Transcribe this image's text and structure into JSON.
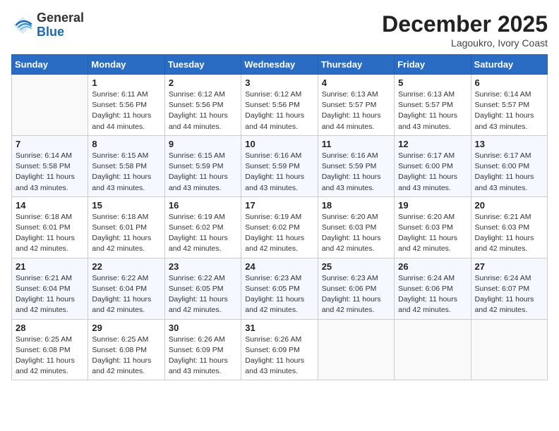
{
  "header": {
    "logo_line1": "General",
    "logo_line2": "Blue",
    "month_title": "December 2025",
    "location": "Lagoukro, Ivory Coast"
  },
  "weekdays": [
    "Sunday",
    "Monday",
    "Tuesday",
    "Wednesday",
    "Thursday",
    "Friday",
    "Saturday"
  ],
  "weeks": [
    [
      {
        "day": "",
        "info": ""
      },
      {
        "day": "1",
        "info": "Sunrise: 6:11 AM\nSunset: 5:56 PM\nDaylight: 11 hours\nand 44 minutes."
      },
      {
        "day": "2",
        "info": "Sunrise: 6:12 AM\nSunset: 5:56 PM\nDaylight: 11 hours\nand 44 minutes."
      },
      {
        "day": "3",
        "info": "Sunrise: 6:12 AM\nSunset: 5:56 PM\nDaylight: 11 hours\nand 44 minutes."
      },
      {
        "day": "4",
        "info": "Sunrise: 6:13 AM\nSunset: 5:57 PM\nDaylight: 11 hours\nand 44 minutes."
      },
      {
        "day": "5",
        "info": "Sunrise: 6:13 AM\nSunset: 5:57 PM\nDaylight: 11 hours\nand 43 minutes."
      },
      {
        "day": "6",
        "info": "Sunrise: 6:14 AM\nSunset: 5:57 PM\nDaylight: 11 hours\nand 43 minutes."
      }
    ],
    [
      {
        "day": "7",
        "info": "Sunrise: 6:14 AM\nSunset: 5:58 PM\nDaylight: 11 hours\nand 43 minutes."
      },
      {
        "day": "8",
        "info": "Sunrise: 6:15 AM\nSunset: 5:58 PM\nDaylight: 11 hours\nand 43 minutes."
      },
      {
        "day": "9",
        "info": "Sunrise: 6:15 AM\nSunset: 5:59 PM\nDaylight: 11 hours\nand 43 minutes."
      },
      {
        "day": "10",
        "info": "Sunrise: 6:16 AM\nSunset: 5:59 PM\nDaylight: 11 hours\nand 43 minutes."
      },
      {
        "day": "11",
        "info": "Sunrise: 6:16 AM\nSunset: 5:59 PM\nDaylight: 11 hours\nand 43 minutes."
      },
      {
        "day": "12",
        "info": "Sunrise: 6:17 AM\nSunset: 6:00 PM\nDaylight: 11 hours\nand 43 minutes."
      },
      {
        "day": "13",
        "info": "Sunrise: 6:17 AM\nSunset: 6:00 PM\nDaylight: 11 hours\nand 43 minutes."
      }
    ],
    [
      {
        "day": "14",
        "info": "Sunrise: 6:18 AM\nSunset: 6:01 PM\nDaylight: 11 hours\nand 42 minutes."
      },
      {
        "day": "15",
        "info": "Sunrise: 6:18 AM\nSunset: 6:01 PM\nDaylight: 11 hours\nand 42 minutes."
      },
      {
        "day": "16",
        "info": "Sunrise: 6:19 AM\nSunset: 6:02 PM\nDaylight: 11 hours\nand 42 minutes."
      },
      {
        "day": "17",
        "info": "Sunrise: 6:19 AM\nSunset: 6:02 PM\nDaylight: 11 hours\nand 42 minutes."
      },
      {
        "day": "18",
        "info": "Sunrise: 6:20 AM\nSunset: 6:03 PM\nDaylight: 11 hours\nand 42 minutes."
      },
      {
        "day": "19",
        "info": "Sunrise: 6:20 AM\nSunset: 6:03 PM\nDaylight: 11 hours\nand 42 minutes."
      },
      {
        "day": "20",
        "info": "Sunrise: 6:21 AM\nSunset: 6:03 PM\nDaylight: 11 hours\nand 42 minutes."
      }
    ],
    [
      {
        "day": "21",
        "info": "Sunrise: 6:21 AM\nSunset: 6:04 PM\nDaylight: 11 hours\nand 42 minutes."
      },
      {
        "day": "22",
        "info": "Sunrise: 6:22 AM\nSunset: 6:04 PM\nDaylight: 11 hours\nand 42 minutes."
      },
      {
        "day": "23",
        "info": "Sunrise: 6:22 AM\nSunset: 6:05 PM\nDaylight: 11 hours\nand 42 minutes."
      },
      {
        "day": "24",
        "info": "Sunrise: 6:23 AM\nSunset: 6:05 PM\nDaylight: 11 hours\nand 42 minutes."
      },
      {
        "day": "25",
        "info": "Sunrise: 6:23 AM\nSunset: 6:06 PM\nDaylight: 11 hours\nand 42 minutes."
      },
      {
        "day": "26",
        "info": "Sunrise: 6:24 AM\nSunset: 6:06 PM\nDaylight: 11 hours\nand 42 minutes."
      },
      {
        "day": "27",
        "info": "Sunrise: 6:24 AM\nSunset: 6:07 PM\nDaylight: 11 hours\nand 42 minutes."
      }
    ],
    [
      {
        "day": "28",
        "info": "Sunrise: 6:25 AM\nSunset: 6:08 PM\nDaylight: 11 hours\nand 42 minutes."
      },
      {
        "day": "29",
        "info": "Sunrise: 6:25 AM\nSunset: 6:08 PM\nDaylight: 11 hours\nand 42 minutes."
      },
      {
        "day": "30",
        "info": "Sunrise: 6:26 AM\nSunset: 6:09 PM\nDaylight: 11 hours\nand 43 minutes."
      },
      {
        "day": "31",
        "info": "Sunrise: 6:26 AM\nSunset: 6:09 PM\nDaylight: 11 hours\nand 43 minutes."
      },
      {
        "day": "",
        "info": ""
      },
      {
        "day": "",
        "info": ""
      },
      {
        "day": "",
        "info": ""
      }
    ]
  ]
}
